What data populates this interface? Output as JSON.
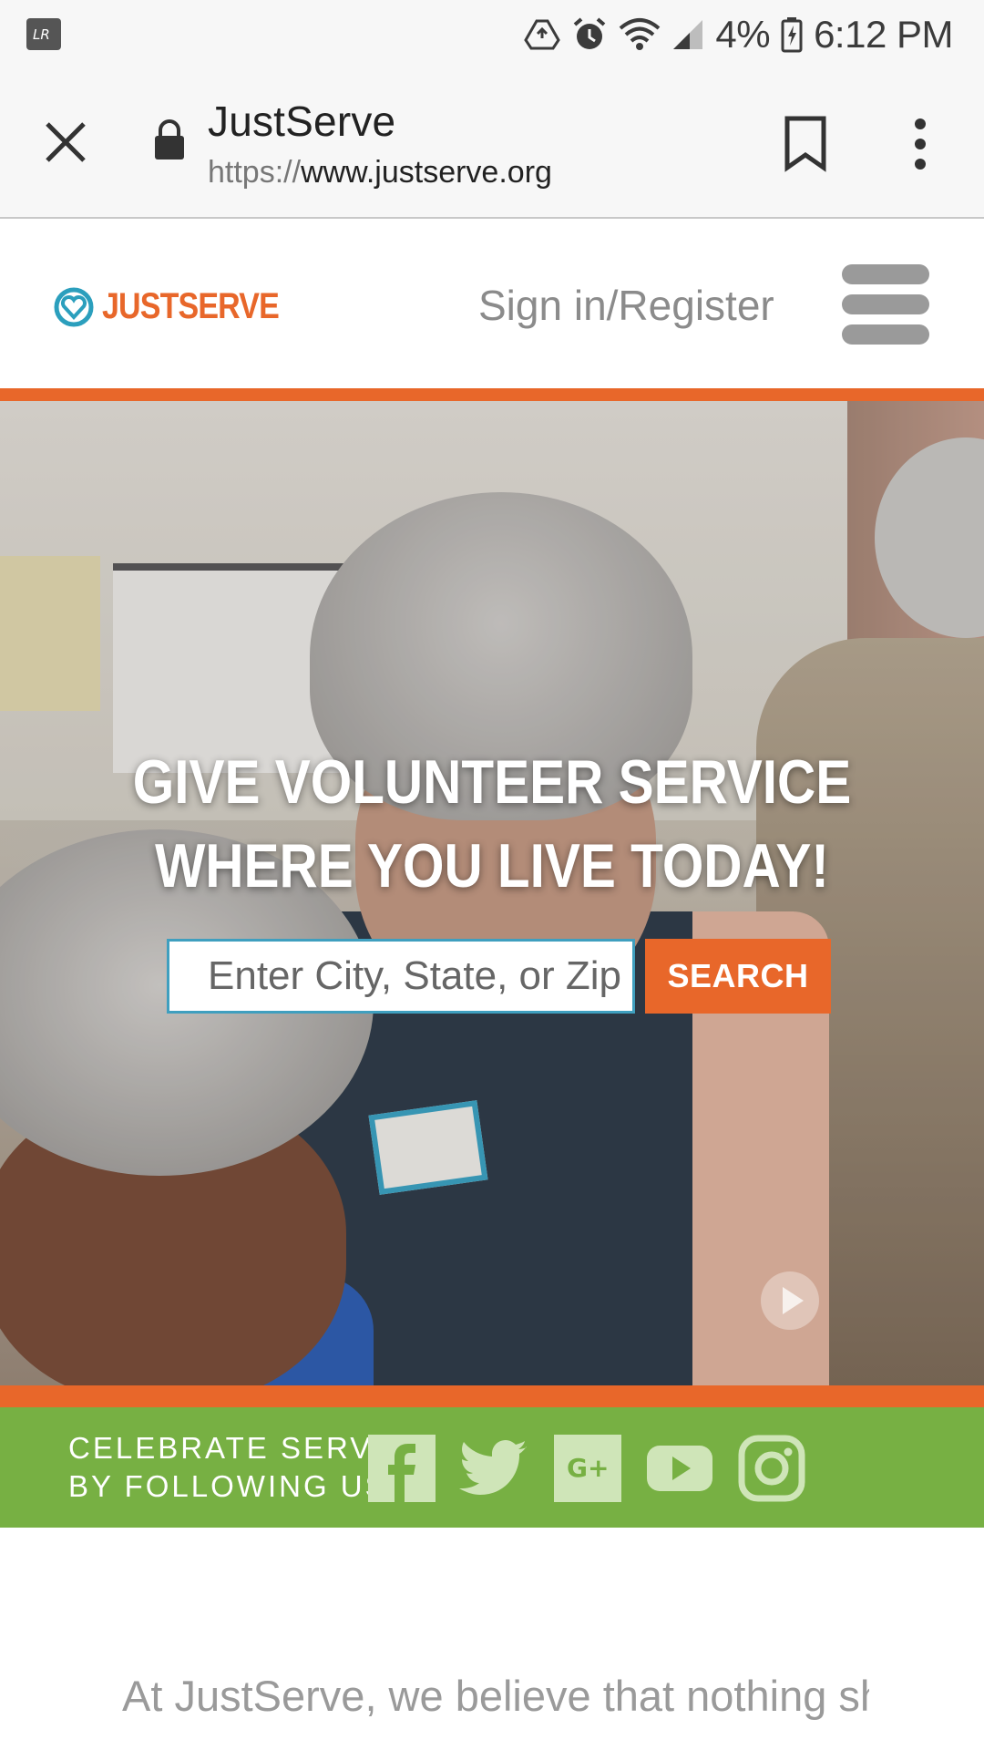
{
  "status_bar": {
    "battery_percent": "4%",
    "time": "6:12 PM",
    "icons": [
      "app-notification-icon",
      "drive-sync-icon",
      "alarm-icon",
      "wifi-icon",
      "signal-icon",
      "battery-charging-icon"
    ]
  },
  "browser": {
    "page_title": "JustServe",
    "url_scheme": "https://",
    "url_host": "www.justserve.org",
    "icons": [
      "close-icon",
      "lock-icon",
      "bookmark-icon",
      "more-vert-icon"
    ]
  },
  "site_header": {
    "logo_text_part1": "JUST",
    "logo_text_part2": "SERVE",
    "signin_label": "Sign in/Register",
    "menu_icon": "hamburger-menu-icon"
  },
  "hero": {
    "title_line1": "GIVE VOLUNTEER SERVICE",
    "title_line2": "WHERE YOU LIVE TODAY!",
    "search_placeholder": "Enter City, State, or Zip",
    "search_value": "",
    "search_button": "SEARCH",
    "play_icon": "play-icon"
  },
  "social": {
    "line1": "CELEBRATE SERVICE",
    "line2": "BY FOLLOWING US",
    "networks": [
      "facebook-icon",
      "twitter-icon",
      "google-plus-icon",
      "youtube-icon",
      "instagram-icon"
    ]
  },
  "intro": {
    "text": "At JustServe, we believe that nothing should get in the way of organizations"
  },
  "colors": {
    "brand_orange": "#e8672a",
    "brand_teal": "#2b9fbd",
    "social_green": "#77b043",
    "header_gray": "#9a9a9a"
  }
}
